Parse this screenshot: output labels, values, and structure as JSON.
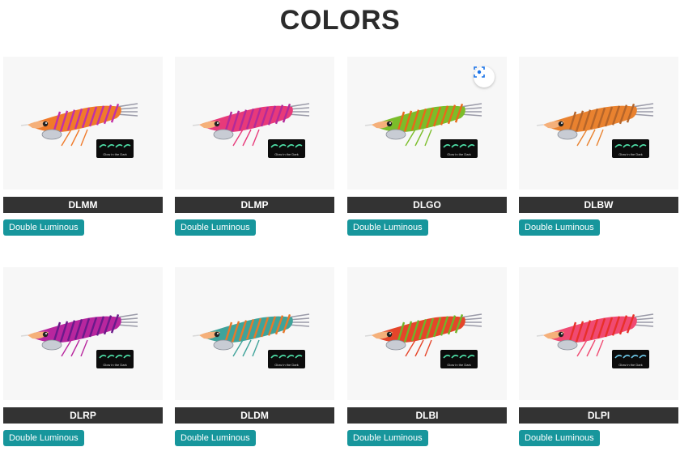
{
  "header": {
    "title": "COLORS"
  },
  "products": [
    {
      "code": "DLMM",
      "badge": "Double Luminous",
      "body_color": "#f07a2a",
      "stripe_color": "#c230a8",
      "glow_color": "#4ee0a8"
    },
    {
      "code": "DLMP",
      "badge": "Double Luminous",
      "body_color": "#e73a7a",
      "stripe_color": "#b22a9a",
      "glow_color": "#4ee0a8"
    },
    {
      "code": "DLGO",
      "badge": "Double Luminous",
      "body_color": "#7bbd2a",
      "stripe_color": "#e86a1a",
      "glow_color": "#4ee0a8"
    },
    {
      "code": "DLBW",
      "badge": "Double Luminous",
      "body_color": "#e9822f",
      "stripe_color": "#b5652a",
      "glow_color": "#4ee0a8"
    },
    {
      "code": "DLRP",
      "badge": "Double Luminous",
      "body_color": "#b8269e",
      "stripe_color": "#6a1a8a",
      "glow_color": "#4ee0a8"
    },
    {
      "code": "DLDM",
      "badge": "Double Luminous",
      "body_color": "#3fa39a",
      "stripe_color": "#e8782a",
      "glow_color": "#4ee0a8"
    },
    {
      "code": "DLBI",
      "badge": "Double Luminous",
      "body_color": "#e5452a",
      "stripe_color": "#6fb52a",
      "glow_color": "#4ee0a8"
    },
    {
      "code": "DLPI",
      "badge": "Double Luminous",
      "body_color": "#f04a72",
      "stripe_color": "#e8302a",
      "glow_color": "#6ec8e8"
    }
  ],
  "glow_label": "Glow in the Dark",
  "image_search_icon": "lens-scan-icon"
}
